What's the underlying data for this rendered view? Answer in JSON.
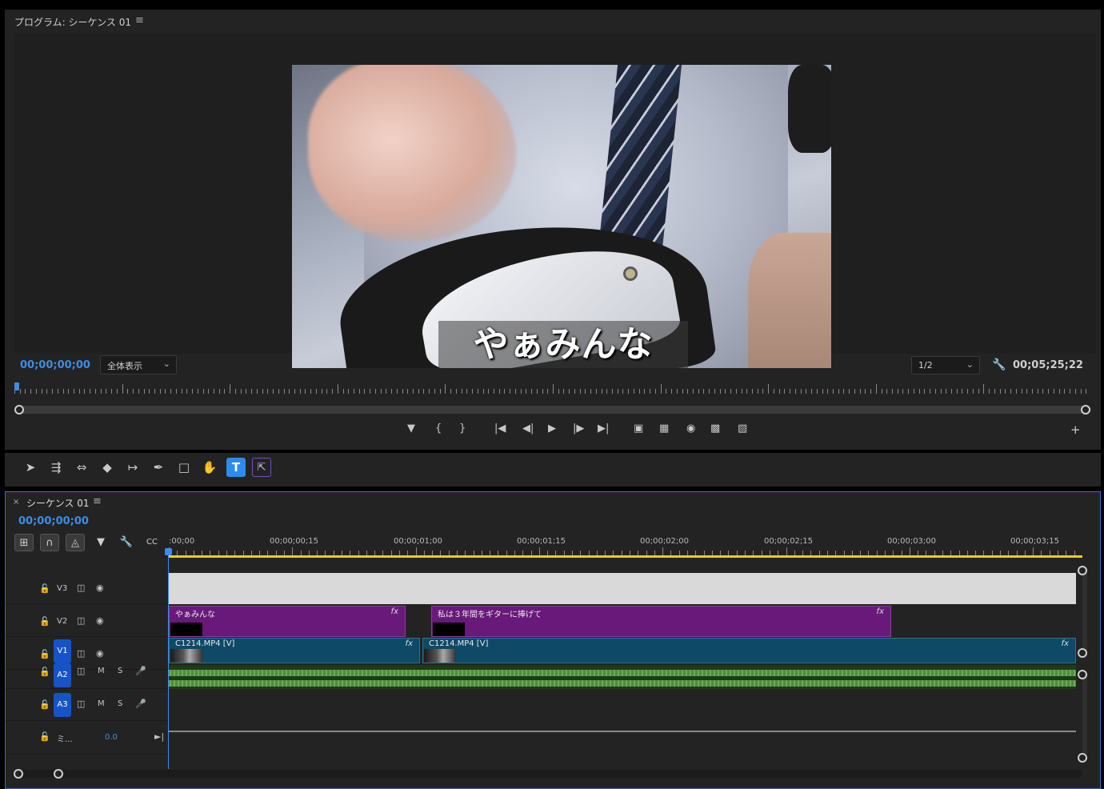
{
  "program": {
    "title": "プログラム: シーケンス 01",
    "menu_icon": "≡",
    "caption": "やぁみんな",
    "current_tc": "00;00;00;00",
    "fit_label": "全体表示",
    "resolution": "1/2",
    "duration_tc": "00;05;25;22"
  },
  "tools": [
    "selection",
    "track-select-forward",
    "ripple-edit",
    "razor",
    "slip",
    "pen",
    "rectangle",
    "hand",
    "type",
    "generative-extend"
  ],
  "timeline": {
    "close": "×",
    "title": "シーケンス 01",
    "menu_icon": "≡",
    "current_tc": "00;00;00;00",
    "ruler_labels": [
      ":00;00",
      "00;00;00;15",
      "00;00;01;00",
      "00;00;01;15",
      "00;00;02;00",
      "00;00;02;15",
      "00;00;03;00",
      "00;00;03;15"
    ],
    "tracks": {
      "v3": {
        "label": "V3"
      },
      "v2": {
        "label": "V2"
      },
      "v1": {
        "label": "V1"
      },
      "a2": {
        "label": "A2",
        "m": "M",
        "s": "S"
      },
      "a3": {
        "label": "A3",
        "m": "M",
        "s": "S"
      },
      "mix": {
        "label": "ミ...",
        "value": "0.0"
      }
    },
    "clips": {
      "v2_a": {
        "label": "やぁみんな",
        "fx": "fx"
      },
      "v2_b": {
        "label": "私は３年間をギターに捧げて",
        "fx": "fx"
      },
      "v1_a": {
        "label": "C1214.MP4 [V]",
        "fx": "fx"
      },
      "v1_b": {
        "label": "C1214.MP4 [V]",
        "fx": "fx"
      }
    }
  },
  "colors": {
    "accent_blue": "#3a8ee6",
    "graphic_clip": "#69197a",
    "video_clip": "#0e4a66",
    "audio_wave": "#6fb35c",
    "work_area": "#e6d11f"
  }
}
